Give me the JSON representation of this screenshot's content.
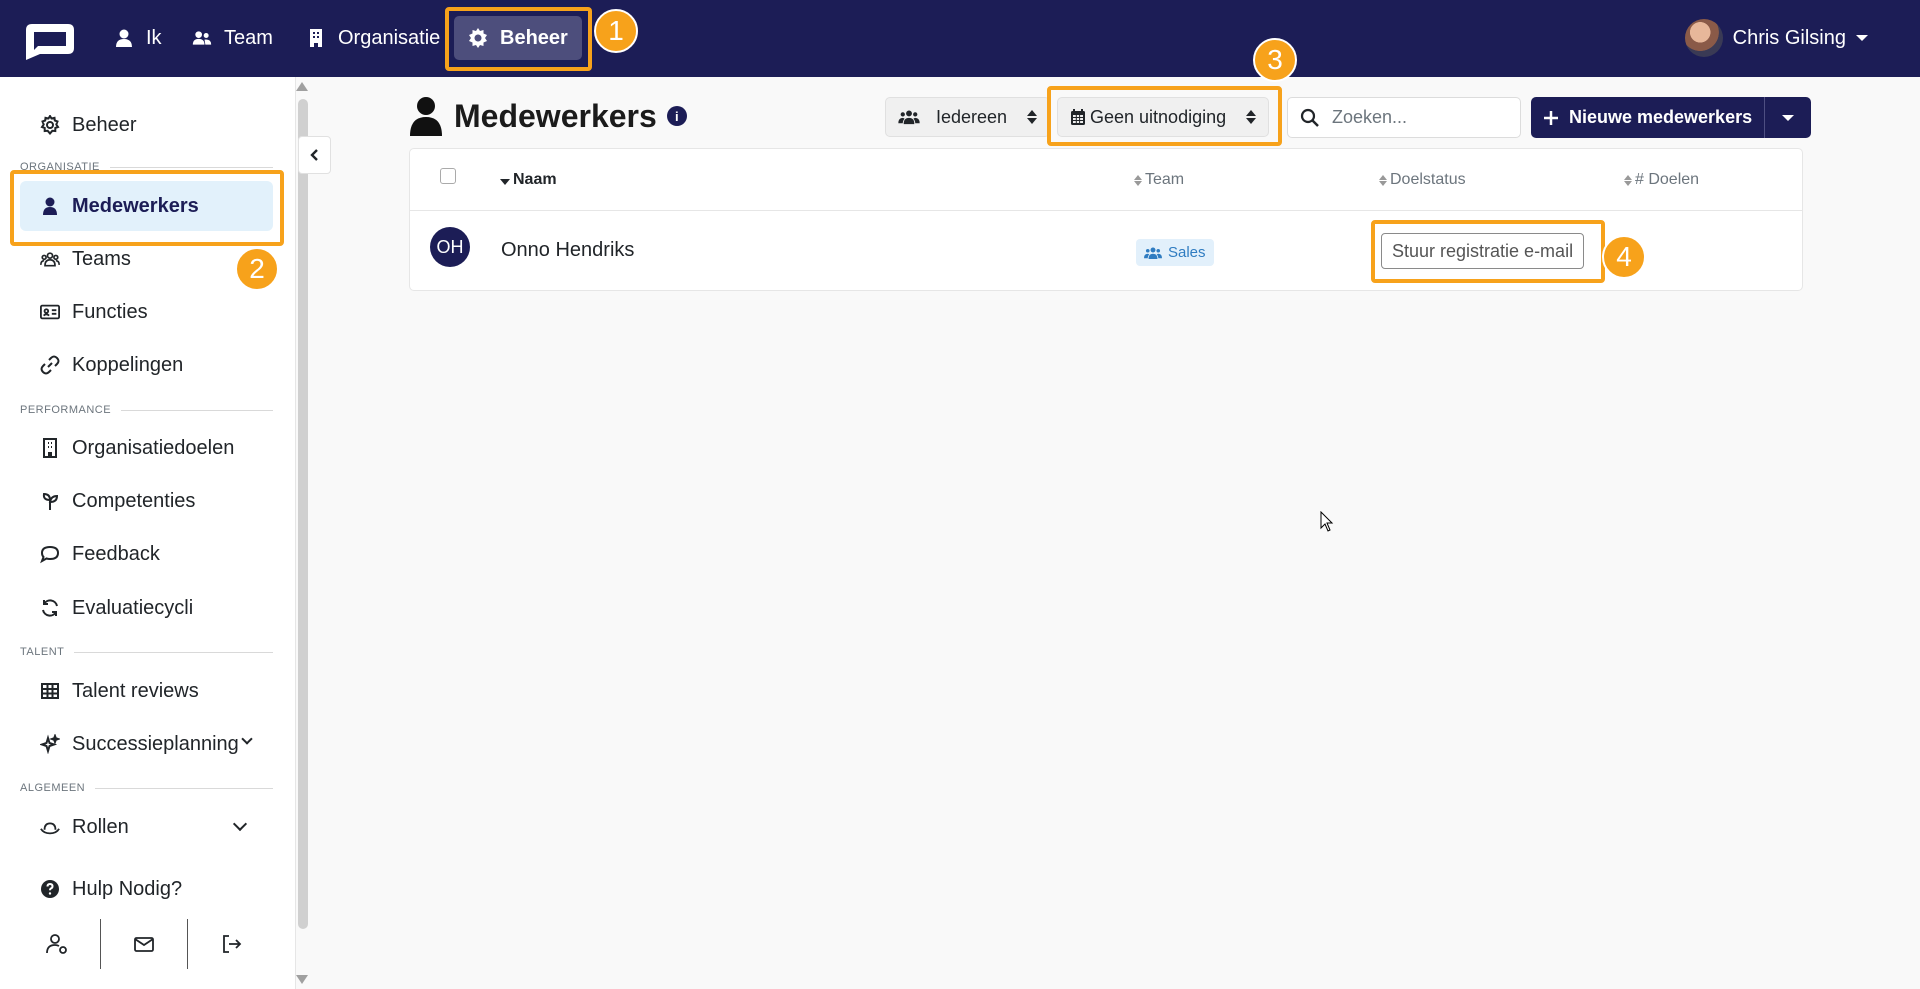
{
  "topnav": {
    "items": [
      {
        "label": "Ik",
        "icon": "user-icon"
      },
      {
        "label": "Team",
        "icon": "users-icon"
      },
      {
        "label": "Organisatie",
        "icon": "building-icon"
      },
      {
        "label": "Beheer",
        "icon": "gear-icon",
        "active": true
      }
    ],
    "user_name": "Chris Gilsing"
  },
  "sidebar": {
    "top_item": "Beheer",
    "sections": {
      "organisatie": "ORGANISATIE",
      "performance": "PERFORMANCE",
      "talent": "TALENT",
      "algemeen": "ALGEMEEN"
    },
    "items": [
      {
        "label": "Medewerkers",
        "active": true
      },
      {
        "label": "Teams"
      },
      {
        "label": "Functies"
      },
      {
        "label": "Koppelingen"
      },
      {
        "label": "Organisatiedoelen"
      },
      {
        "label": "Competenties"
      },
      {
        "label": "Feedback"
      },
      {
        "label": "Evaluatiecycli"
      },
      {
        "label": "Talent reviews"
      },
      {
        "label": "Successieplanning"
      },
      {
        "label": "Rollen"
      },
      {
        "label": "Hulp Nodig?"
      }
    ]
  },
  "main": {
    "title": "Medewerkers",
    "filters": {
      "people": "Iedereen",
      "invitation": "Geen uitnodiging"
    },
    "search": {
      "placeholder": "Zoeken..."
    },
    "new_button": "Nieuwe medewerkers",
    "table": {
      "columns": [
        "Naam",
        "Team",
        "Doelstatus",
        "# Doelen"
      ],
      "rows": [
        {
          "initials": "OH",
          "name": "Onno Hendriks",
          "team": "Sales",
          "action": "Stuur registratie e-mail"
        }
      ]
    }
  },
  "callouts": [
    "1",
    "2",
    "3",
    "4"
  ],
  "colors": {
    "navy": "#1c1d56",
    "highlight": "#f7a21b",
    "active_bg": "#e2f1fb"
  }
}
